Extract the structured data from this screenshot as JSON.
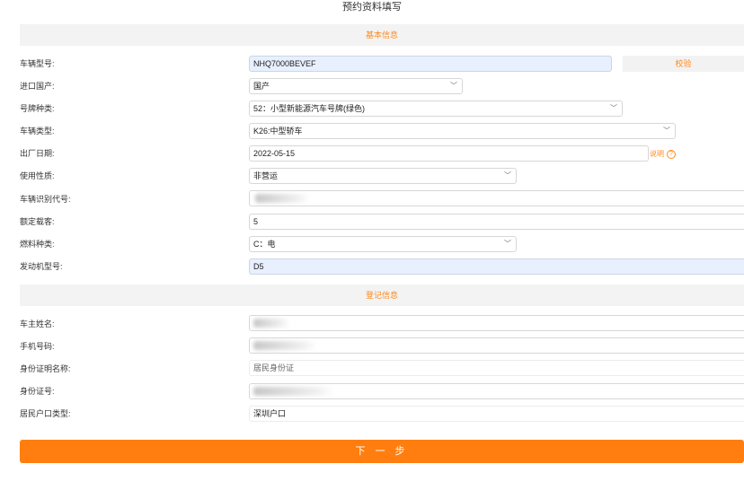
{
  "page_title": "预约资料填写",
  "sections": {
    "basic": "基本信息",
    "register": "登记信息"
  },
  "basic_fields": {
    "vehicle_model": {
      "label": "车辆型号:",
      "value": "NHQ7000BEVEF"
    },
    "import_domestic": {
      "label": "进口国产:",
      "value": "国产"
    },
    "plate_type": {
      "label": "号牌种类:",
      "value": "52：小型新能源汽车号牌(绿色)"
    },
    "vehicle_type": {
      "label": "车辆类型:",
      "value": "K26:中型轿车"
    },
    "manufacture_date": {
      "label": "出厂日期:",
      "value": "2022-05-15"
    },
    "usage_nature": {
      "label": "使用性质:",
      "value": "非营运"
    },
    "vin": {
      "label": "车辆识别代号:",
      "value": ""
    },
    "rated_passengers": {
      "label": "额定载客:",
      "value": "5"
    },
    "fuel_type": {
      "label": "燃料种类:",
      "value": "C：电"
    },
    "engine_model": {
      "label": "发动机型号:",
      "value": "D5"
    }
  },
  "register_fields": {
    "owner_name": {
      "label": "车主姓名:",
      "value": ""
    },
    "phone": {
      "label": "手机号码:",
      "value": ""
    },
    "id_doc_name": {
      "label": "身份证明名称:",
      "value": "居民身份证"
    },
    "id_number": {
      "label": "身份证号:",
      "value": ""
    },
    "household_type": {
      "label": "居民户口类型:",
      "value": "深圳户口"
    }
  },
  "verify_button": "校验",
  "date_hint": "说明",
  "date_hint_icon": "question-circle-icon",
  "next_button": "下 一 步",
  "colors": {
    "accent": "#ff7e0f",
    "header_bg": "#f3f3f3",
    "autofill_bg": "#e8f0fe"
  }
}
